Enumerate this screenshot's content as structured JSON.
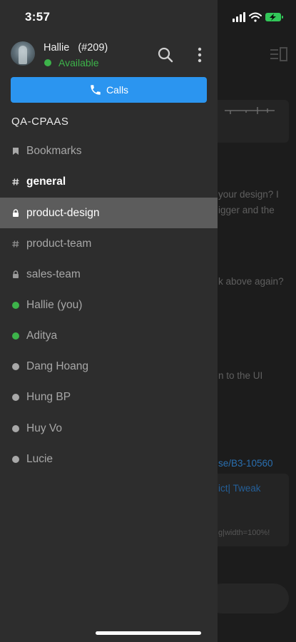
{
  "status_bar": {
    "time": "3:57"
  },
  "user": {
    "name": "Hallie   (#209)",
    "status": "Available",
    "status_color": "#3db34a"
  },
  "calls_button": {
    "label": "Calls",
    "color": "#2b95f0"
  },
  "team": {
    "name": "QA-CPAAS"
  },
  "sidebar": {
    "items": [
      {
        "label": "Bookmarks",
        "icon": "bookmark-icon"
      },
      {
        "label": "general",
        "icon": "hash-icon"
      },
      {
        "label": "product-design",
        "icon": "lock-icon"
      },
      {
        "label": "product-team",
        "icon": "hash-icon"
      },
      {
        "label": "sales-team",
        "icon": "lock-icon"
      },
      {
        "label": "Hallie (you)",
        "icon": "online-status-icon"
      },
      {
        "label": "Aditya",
        "icon": "online-status-icon"
      },
      {
        "label": "Dang Hoang",
        "icon": "offline-status-icon"
      },
      {
        "label": "Hung BP",
        "icon": "offline-status-icon"
      },
      {
        "label": "Huy Vo",
        "icon": "offline-status-icon"
      },
      {
        "label": "Lucie",
        "icon": "offline-status-icon"
      }
    ]
  },
  "background_chat": {
    "line1": "your design? I",
    "line2": "igger and the",
    "line3": "k above again?",
    "line4": "n to the UI",
    "link1": "se/B3-10560",
    "link2": "ict| Tweak",
    "snippet": "g|width=100%!"
  }
}
